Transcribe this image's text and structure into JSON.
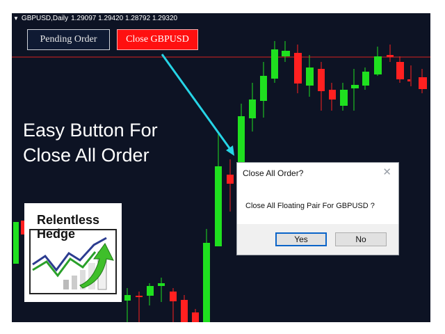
{
  "chart_header": {
    "symbol": "GBPUSD,Daily",
    "prices": "1.29097 1.29420 1.28792 1.29320"
  },
  "toolbar": {
    "pending_label": "Pending Order",
    "close_label": "Close GBPUSD"
  },
  "overlay": {
    "line1": "Easy Button For",
    "line2": "Close All Order"
  },
  "logo": {
    "line1": "Relentless",
    "line2": "Hedge"
  },
  "dialog": {
    "title": "Close All Order?",
    "close_glyph": "✕",
    "message": "Close All Floating Pair For GBPUSD ?",
    "yes_label": "Yes",
    "no_label": "No"
  },
  "colors": {
    "chart_bg": "#0d1324",
    "bull": "#1fe01f",
    "bear": "#ff2020",
    "accent_arrow": "#26d4e6",
    "price_line": "#d62020"
  }
}
